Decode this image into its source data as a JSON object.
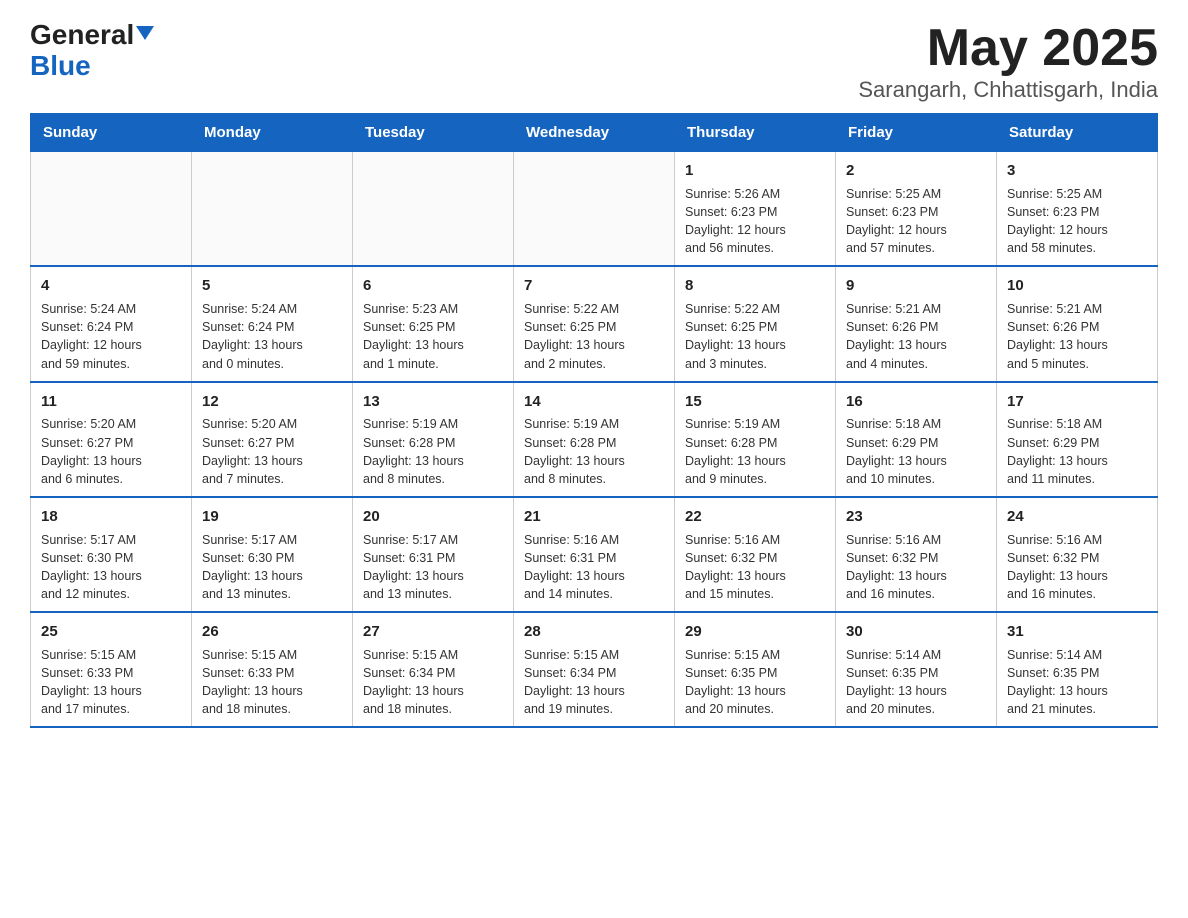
{
  "header": {
    "logo_line1": "General",
    "logo_line2": "Blue",
    "title": "May 2025",
    "subtitle": "Sarangarh, Chhattisgarh, India"
  },
  "weekdays": [
    "Sunday",
    "Monday",
    "Tuesday",
    "Wednesday",
    "Thursday",
    "Friday",
    "Saturday"
  ],
  "weeks": [
    [
      {
        "day": "",
        "info": ""
      },
      {
        "day": "",
        "info": ""
      },
      {
        "day": "",
        "info": ""
      },
      {
        "day": "",
        "info": ""
      },
      {
        "day": "1",
        "info": "Sunrise: 5:26 AM\nSunset: 6:23 PM\nDaylight: 12 hours\nand 56 minutes."
      },
      {
        "day": "2",
        "info": "Sunrise: 5:25 AM\nSunset: 6:23 PM\nDaylight: 12 hours\nand 57 minutes."
      },
      {
        "day": "3",
        "info": "Sunrise: 5:25 AM\nSunset: 6:23 PM\nDaylight: 12 hours\nand 58 minutes."
      }
    ],
    [
      {
        "day": "4",
        "info": "Sunrise: 5:24 AM\nSunset: 6:24 PM\nDaylight: 12 hours\nand 59 minutes."
      },
      {
        "day": "5",
        "info": "Sunrise: 5:24 AM\nSunset: 6:24 PM\nDaylight: 13 hours\nand 0 minutes."
      },
      {
        "day": "6",
        "info": "Sunrise: 5:23 AM\nSunset: 6:25 PM\nDaylight: 13 hours\nand 1 minute."
      },
      {
        "day": "7",
        "info": "Sunrise: 5:22 AM\nSunset: 6:25 PM\nDaylight: 13 hours\nand 2 minutes."
      },
      {
        "day": "8",
        "info": "Sunrise: 5:22 AM\nSunset: 6:25 PM\nDaylight: 13 hours\nand 3 minutes."
      },
      {
        "day": "9",
        "info": "Sunrise: 5:21 AM\nSunset: 6:26 PM\nDaylight: 13 hours\nand 4 minutes."
      },
      {
        "day": "10",
        "info": "Sunrise: 5:21 AM\nSunset: 6:26 PM\nDaylight: 13 hours\nand 5 minutes."
      }
    ],
    [
      {
        "day": "11",
        "info": "Sunrise: 5:20 AM\nSunset: 6:27 PM\nDaylight: 13 hours\nand 6 minutes."
      },
      {
        "day": "12",
        "info": "Sunrise: 5:20 AM\nSunset: 6:27 PM\nDaylight: 13 hours\nand 7 minutes."
      },
      {
        "day": "13",
        "info": "Sunrise: 5:19 AM\nSunset: 6:28 PM\nDaylight: 13 hours\nand 8 minutes."
      },
      {
        "day": "14",
        "info": "Sunrise: 5:19 AM\nSunset: 6:28 PM\nDaylight: 13 hours\nand 8 minutes."
      },
      {
        "day": "15",
        "info": "Sunrise: 5:19 AM\nSunset: 6:28 PM\nDaylight: 13 hours\nand 9 minutes."
      },
      {
        "day": "16",
        "info": "Sunrise: 5:18 AM\nSunset: 6:29 PM\nDaylight: 13 hours\nand 10 minutes."
      },
      {
        "day": "17",
        "info": "Sunrise: 5:18 AM\nSunset: 6:29 PM\nDaylight: 13 hours\nand 11 minutes."
      }
    ],
    [
      {
        "day": "18",
        "info": "Sunrise: 5:17 AM\nSunset: 6:30 PM\nDaylight: 13 hours\nand 12 minutes."
      },
      {
        "day": "19",
        "info": "Sunrise: 5:17 AM\nSunset: 6:30 PM\nDaylight: 13 hours\nand 13 minutes."
      },
      {
        "day": "20",
        "info": "Sunrise: 5:17 AM\nSunset: 6:31 PM\nDaylight: 13 hours\nand 13 minutes."
      },
      {
        "day": "21",
        "info": "Sunrise: 5:16 AM\nSunset: 6:31 PM\nDaylight: 13 hours\nand 14 minutes."
      },
      {
        "day": "22",
        "info": "Sunrise: 5:16 AM\nSunset: 6:32 PM\nDaylight: 13 hours\nand 15 minutes."
      },
      {
        "day": "23",
        "info": "Sunrise: 5:16 AM\nSunset: 6:32 PM\nDaylight: 13 hours\nand 16 minutes."
      },
      {
        "day": "24",
        "info": "Sunrise: 5:16 AM\nSunset: 6:32 PM\nDaylight: 13 hours\nand 16 minutes."
      }
    ],
    [
      {
        "day": "25",
        "info": "Sunrise: 5:15 AM\nSunset: 6:33 PM\nDaylight: 13 hours\nand 17 minutes."
      },
      {
        "day": "26",
        "info": "Sunrise: 5:15 AM\nSunset: 6:33 PM\nDaylight: 13 hours\nand 18 minutes."
      },
      {
        "day": "27",
        "info": "Sunrise: 5:15 AM\nSunset: 6:34 PM\nDaylight: 13 hours\nand 18 minutes."
      },
      {
        "day": "28",
        "info": "Sunrise: 5:15 AM\nSunset: 6:34 PM\nDaylight: 13 hours\nand 19 minutes."
      },
      {
        "day": "29",
        "info": "Sunrise: 5:15 AM\nSunset: 6:35 PM\nDaylight: 13 hours\nand 20 minutes."
      },
      {
        "day": "30",
        "info": "Sunrise: 5:14 AM\nSunset: 6:35 PM\nDaylight: 13 hours\nand 20 minutes."
      },
      {
        "day": "31",
        "info": "Sunrise: 5:14 AM\nSunset: 6:35 PM\nDaylight: 13 hours\nand 21 minutes."
      }
    ]
  ]
}
